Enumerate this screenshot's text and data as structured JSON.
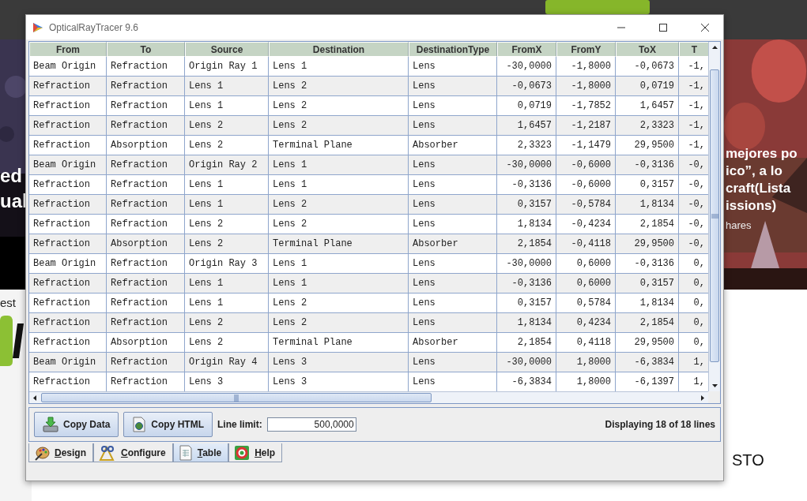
{
  "background_page": {
    "left_headline": [
      "ed",
      "ual"
    ],
    "left_caption": "est",
    "right_headline": [
      "mejores po",
      "ico”, a lo",
      "craft(Lista",
      "issions)"
    ],
    "right_caption": "hares",
    "right_section_title": "STO"
  },
  "window": {
    "title": "OpticalRayTracer 9.6"
  },
  "table": {
    "columns": [
      {
        "label": "From",
        "kind": "text"
      },
      {
        "label": "To",
        "kind": "text"
      },
      {
        "label": "Source",
        "kind": "text"
      },
      {
        "label": "Destination",
        "kind": "text"
      },
      {
        "label": "DestinationType",
        "kind": "text"
      },
      {
        "label": "FromX",
        "kind": "number"
      },
      {
        "label": "FromY",
        "kind": "number"
      },
      {
        "label": "ToX",
        "kind": "number"
      },
      {
        "label": "T",
        "kind": "number"
      }
    ],
    "rows": [
      [
        "Beam Origin",
        "Refraction",
        "Origin Ray 1",
        "Lens 1",
        "Lens",
        "-30,0000",
        "-1,8000",
        "-0,0673",
        "-1,"
      ],
      [
        "Refraction",
        "Refraction",
        "Lens 1",
        "Lens 2",
        "Lens",
        "-0,0673",
        "-1,8000",
        "0,0719",
        "-1,"
      ],
      [
        "Refraction",
        "Refraction",
        "Lens 1",
        "Lens 2",
        "Lens",
        "0,0719",
        "-1,7852",
        "1,6457",
        "-1,"
      ],
      [
        "Refraction",
        "Refraction",
        "Lens 2",
        "Lens 2",
        "Lens",
        "1,6457",
        "-1,2187",
        "2,3323",
        "-1,"
      ],
      [
        "Refraction",
        "Absorption",
        "Lens 2",
        "Terminal Plane",
        "Absorber",
        "2,3323",
        "-1,1479",
        "29,9500",
        "-1,"
      ],
      [
        "Beam Origin",
        "Refraction",
        "Origin Ray 2",
        "Lens 1",
        "Lens",
        "-30,0000",
        "-0,6000",
        "-0,3136",
        "-0,"
      ],
      [
        "Refraction",
        "Refraction",
        "Lens 1",
        "Lens 1",
        "Lens",
        "-0,3136",
        "-0,6000",
        "0,3157",
        "-0,"
      ],
      [
        "Refraction",
        "Refraction",
        "Lens 1",
        "Lens 2",
        "Lens",
        "0,3157",
        "-0,5784",
        "1,8134",
        "-0,"
      ],
      [
        "Refraction",
        "Refraction",
        "Lens 2",
        "Lens 2",
        "Lens",
        "1,8134",
        "-0,4234",
        "2,1854",
        "-0,"
      ],
      [
        "Refraction",
        "Absorption",
        "Lens 2",
        "Terminal Plane",
        "Absorber",
        "2,1854",
        "-0,4118",
        "29,9500",
        "-0,"
      ],
      [
        "Beam Origin",
        "Refraction",
        "Origin Ray 3",
        "Lens 1",
        "Lens",
        "-30,0000",
        "0,6000",
        "-0,3136",
        "0,"
      ],
      [
        "Refraction",
        "Refraction",
        "Lens 1",
        "Lens 1",
        "Lens",
        "-0,3136",
        "0,6000",
        "0,3157",
        "0,"
      ],
      [
        "Refraction",
        "Refraction",
        "Lens 1",
        "Lens 2",
        "Lens",
        "0,3157",
        "0,5784",
        "1,8134",
        "0,"
      ],
      [
        "Refraction",
        "Refraction",
        "Lens 2",
        "Lens 2",
        "Lens",
        "1,8134",
        "0,4234",
        "2,1854",
        "0,"
      ],
      [
        "Refraction",
        "Absorption",
        "Lens 2",
        "Terminal Plane",
        "Absorber",
        "2,1854",
        "0,4118",
        "29,9500",
        "0,"
      ],
      [
        "Beam Origin",
        "Refraction",
        "Origin Ray 4",
        "Lens 3",
        "Lens",
        "-30,0000",
        "1,8000",
        "-6,3834",
        "1,"
      ],
      [
        "Refraction",
        "Refraction",
        "Lens 3",
        "Lens 3",
        "Lens",
        "-6,3834",
        "1,8000",
        "-6,1397",
        "1,"
      ]
    ]
  },
  "actions": [
    {
      "label": "Copy Data",
      "kind": "data"
    },
    {
      "label": "Copy HTML",
      "kind": "html"
    }
  ],
  "line_limit": {
    "label": "Line limit:",
    "value": "500,0000"
  },
  "status": "Displaying 18 of 18 lines",
  "tabs": [
    {
      "label": "Design",
      "kind": "design",
      "selected": false
    },
    {
      "label": "Configure",
      "kind": "configure",
      "selected": false
    },
    {
      "label": "Table",
      "kind": "table",
      "selected": true
    },
    {
      "label": "Help",
      "kind": "help",
      "selected": false
    }
  ]
}
